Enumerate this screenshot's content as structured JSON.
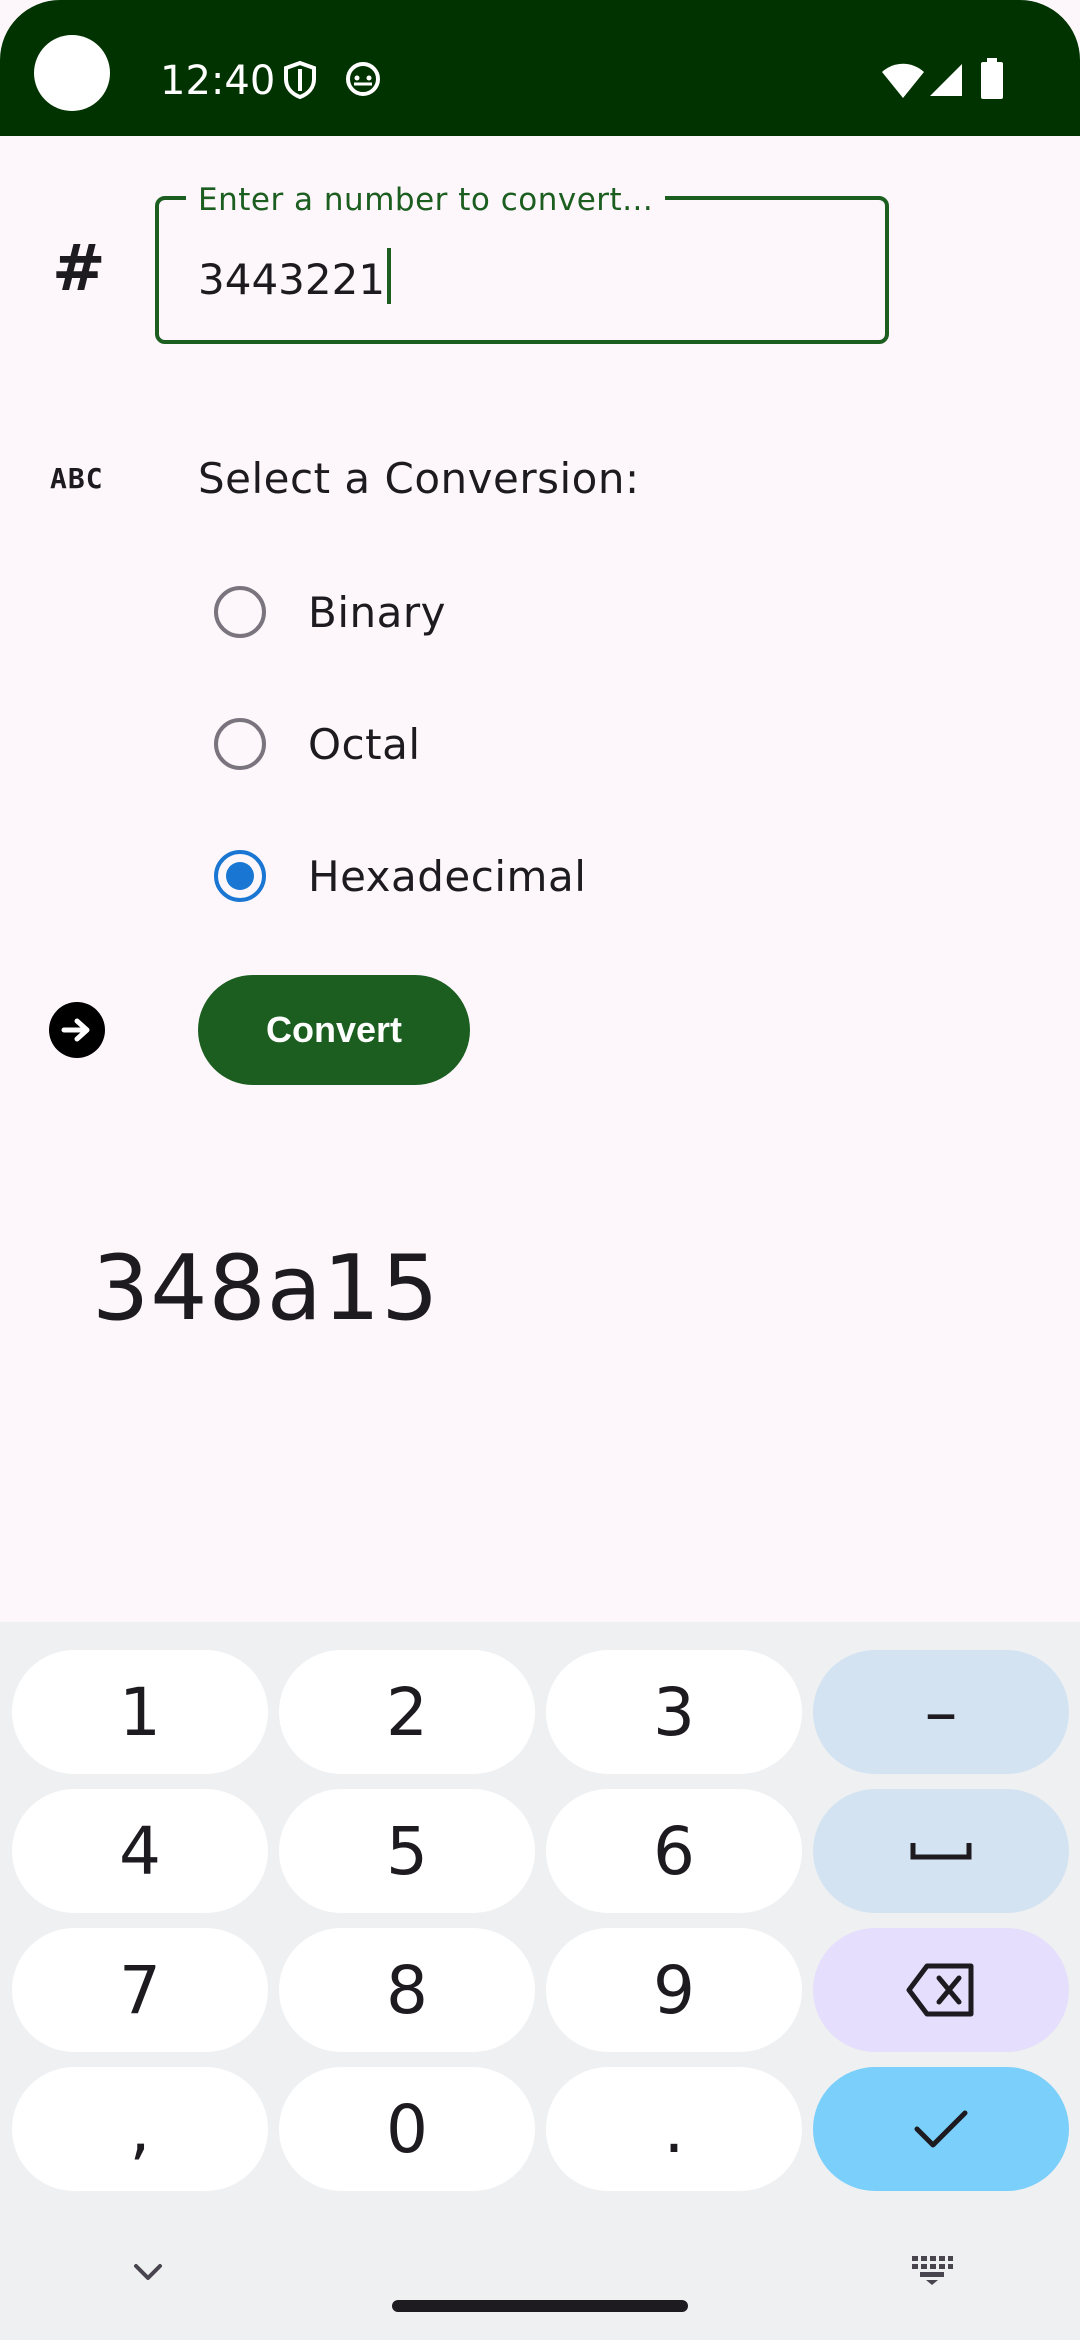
{
  "status_bar": {
    "time": "12:40"
  },
  "input": {
    "label": "Enter a number to convert...",
    "value": "3443221"
  },
  "conversion": {
    "label": "Select a Conversion:",
    "options": [
      {
        "label": "Binary",
        "selected": false
      },
      {
        "label": "Octal",
        "selected": false
      },
      {
        "label": "Hexadecimal",
        "selected": true
      }
    ]
  },
  "icons": {
    "hash": "#",
    "abc": "ABC"
  },
  "convert_button": {
    "label": "Convert"
  },
  "result": {
    "value": "348a15"
  },
  "keyboard": {
    "keys": [
      "1",
      "2",
      "3",
      "–",
      "4",
      "5",
      "6",
      "␣",
      "7",
      "8",
      "9",
      "⌫",
      ",",
      "0",
      ".",
      "✓"
    ]
  },
  "colors": {
    "primary": "#1b5e20",
    "status_bar": "#003300",
    "radio_selected": "#1976d2",
    "background": "#fdf7fb"
  }
}
